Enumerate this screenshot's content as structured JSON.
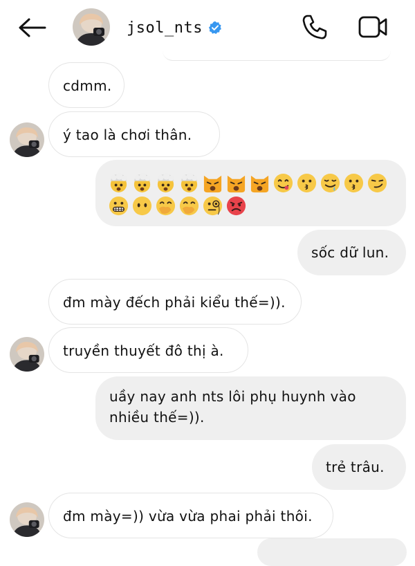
{
  "header": {
    "username": "jsol_nts",
    "verified": true,
    "icons": {
      "back": "back-arrow-icon",
      "verified": "verified-badge-icon",
      "call": "phone-icon",
      "video": "video-camera-icon"
    },
    "verified_color": "#3797f0"
  },
  "colors": {
    "incoming_bubble": "#ffffff",
    "incoming_border": "#e4e4e4",
    "outgoing_bubble": "#efefef",
    "text": "#111111"
  },
  "messages": [
    {
      "direction": "in",
      "text": "cdmm."
    },
    {
      "direction": "in",
      "text": "ý tao là chơi thân."
    },
    {
      "direction": "out",
      "type": "emoji",
      "emojis": [
        "exploding-head",
        "exploding-head",
        "exploding-head",
        "exploding-head",
        "weary-cat",
        "weary-cat",
        "weary-cat",
        "face-savoring-food",
        "kissing-face",
        "drooling-face",
        "kissing-face",
        "smirking-face",
        "grimacing-face",
        "face-without-mouth",
        "face-with-hand-over-mouth",
        "face-with-hand-over-mouth",
        "face-with-monocle",
        "pouting-face"
      ]
    },
    {
      "direction": "out",
      "text": "sốc dữ lun."
    },
    {
      "direction": "in",
      "text": "đm mày đếch phải kiểu thế=))."
    },
    {
      "direction": "in",
      "text": "truyền thuyết đô thị à."
    },
    {
      "direction": "out",
      "text": "uầy nay anh nts lôi phụ huynh vào nhiều thế=))."
    },
    {
      "direction": "out",
      "text": "trẻ trâu."
    },
    {
      "direction": "in",
      "text": "đm mày=)) vừa vừa phai phải thôi."
    }
  ]
}
